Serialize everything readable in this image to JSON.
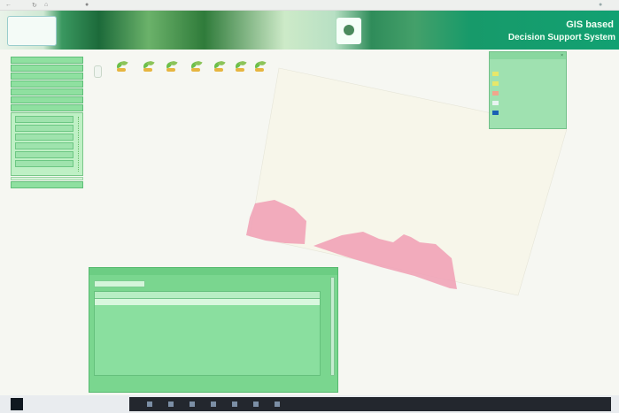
{
  "browser": {
    "url": "",
    "nav_icons": [
      "back-icon",
      "refresh-icon",
      "home-icon"
    ]
  },
  "banner": {
    "title_line1": "GIS based",
    "title_line2": "Decision Support System",
    "logo_text": ""
  },
  "left_menu": {
    "items": [
      "",
      "",
      "",
      "",
      "",
      "",
      ""
    ],
    "submenu_items": [
      "",
      "",
      "",
      "",
      "",
      ""
    ],
    "bottom_item": ""
  },
  "map": {
    "tool_icons": [
      "plant-tool-icon",
      "plant-tool-icon",
      "plant-tool-icon",
      "plant-tool-icon",
      "plant-tool-icon",
      "plant-tool-icon",
      "plant-tool-icon"
    ],
    "label1": "",
    "label2": "",
    "link": ""
  },
  "legend": {
    "header": "",
    "rows": [
      {
        "label": "",
        "color": "#9fe1b0"
      },
      {
        "label": "",
        "color": "#e7e76a"
      },
      {
        "label": "",
        "color": "#e7e76a"
      },
      {
        "label": "",
        "color": "#f1a58c"
      },
      {
        "label": "",
        "color": "#e8f3f0"
      },
      {
        "label": "",
        "color": "#1a5fb4"
      }
    ]
  },
  "panel": {
    "header": "",
    "tab": "",
    "columns": [
      "",
      "",
      ""
    ],
    "rows": [
      [
        "",
        "",
        ""
      ]
    ],
    "footer": ""
  },
  "taskbar": {
    "search_placeholder": ""
  },
  "colors": {
    "banner_green": "#12a172",
    "menu_green": "#8fe0a0",
    "panel_green": "#7ad68f",
    "polygon_pink": "#f2a1b8",
    "map_cream": "#f7f6ea"
  }
}
